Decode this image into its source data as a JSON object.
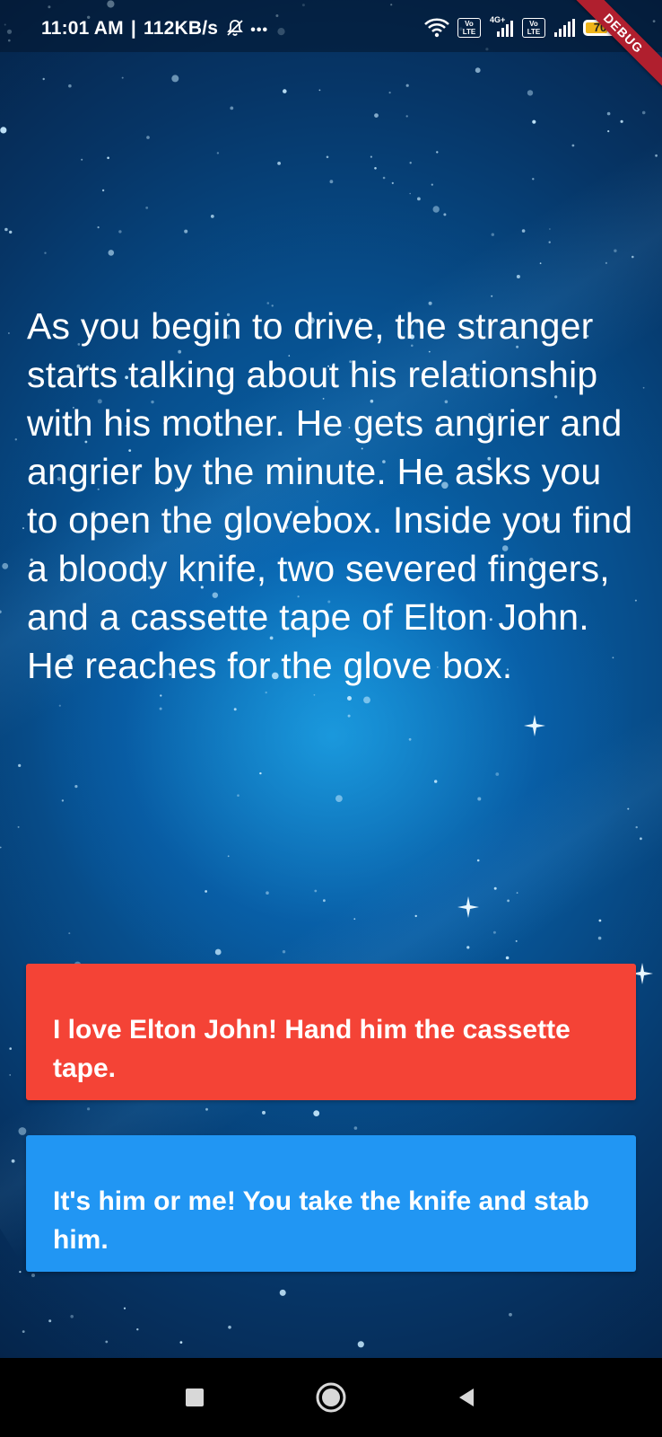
{
  "status_bar": {
    "time": "11:01 AM",
    "separator": "|",
    "network_speed": "112KB/s",
    "more_indicator": "•••",
    "sim1_label": "Vo LTE",
    "network_type": "4G+",
    "sim2_label": "Vo LTE",
    "battery_level": "70",
    "icons": [
      "mute-bell-icon",
      "wifi-icon",
      "signal-icon",
      "signal-icon",
      "battery-icon"
    ]
  },
  "debug_banner": "DEBUG",
  "story": {
    "text": "As you begin to drive, the stranger starts talking about his relationship with his mother. He gets angrier and angrier by the minute. He asks you to open the glovebox. Inside you find a bloody knife, two severed fingers, and a cassette tape of Elton John. He reaches for the glove box."
  },
  "choices": [
    {
      "label": "I love Elton John! Hand him the cassette tape.",
      "color": "#f44336"
    },
    {
      "label": "It's him or me! You take the knife and stab him.",
      "color": "#2196f3"
    }
  ],
  "nav": {
    "buttons": [
      "recents-square-icon",
      "home-circle-icon",
      "back-triangle-icon"
    ]
  }
}
